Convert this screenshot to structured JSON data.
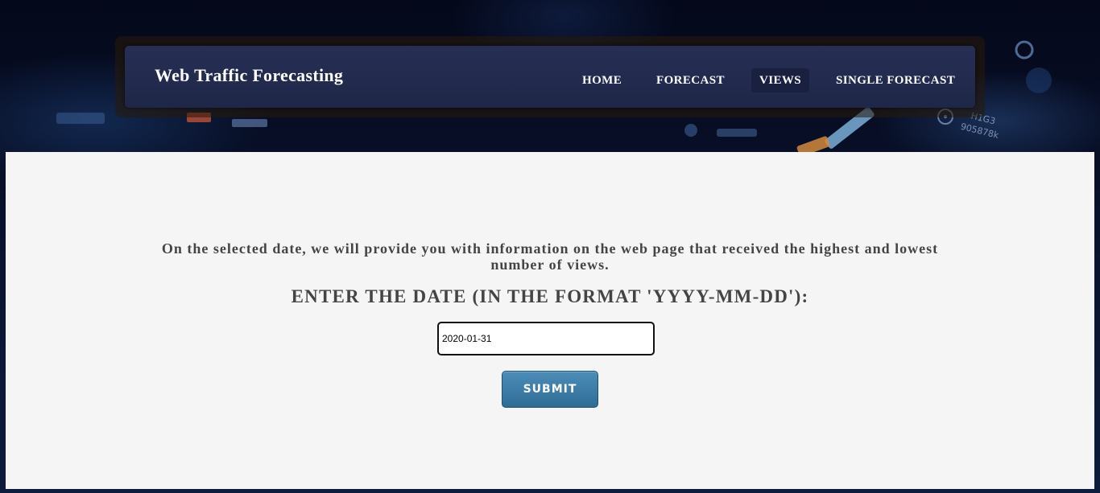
{
  "navbar": {
    "brand": "Web Traffic Forecasting",
    "links": [
      {
        "label": "HOME"
      },
      {
        "label": "FORECAST"
      },
      {
        "label": "VIEWS",
        "active": true
      },
      {
        "label": "SINGLE FORECAST"
      }
    ]
  },
  "main": {
    "intro_text": "On the selected date, we will provide you with information on the web page that received the highest and lowest number of views.",
    "prompt_label": "ENTER THE DATE (IN THE FORMAT 'YYYY-MM-DD'):",
    "date_input_value": "2020-01-31",
    "submit_label": "SUBMIT"
  },
  "background": {
    "overlay_text": [
      "H1G3",
      "905878k"
    ]
  },
  "colors": {
    "nav_bg": "#232b50",
    "content_bg": "#f5f5f5",
    "button_blue": "#3a7aa5",
    "text_gray": "#444444"
  }
}
